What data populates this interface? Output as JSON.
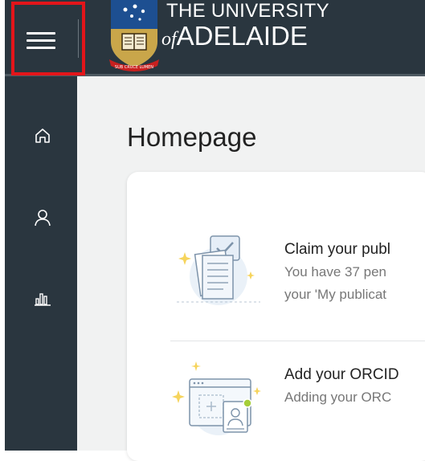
{
  "header": {
    "menu_icon": "hamburger-menu-icon",
    "logo": {
      "line1": "THE UNIVERSITY",
      "of": "of",
      "line2": "ADELAIDE",
      "motto": "SUB CRUCE LUMEN"
    },
    "colors": {
      "bar": "#2a363f",
      "highlight": "#e3151a"
    }
  },
  "sidebar": {
    "items": [
      {
        "icon": "home-icon"
      },
      {
        "icon": "user-icon"
      },
      {
        "icon": "bar-chart-icon"
      }
    ]
  },
  "page": {
    "title": "Homepage"
  },
  "tasks": [
    {
      "icon": "claim-publications-illustration",
      "title": "Claim your publ",
      "desc_line1": "You have 37 pen",
      "desc_line2": "your 'My publicat"
    },
    {
      "icon": "add-orcid-illustration",
      "title": "Add your ORCID",
      "desc_line1": "Adding your ORC"
    }
  ]
}
